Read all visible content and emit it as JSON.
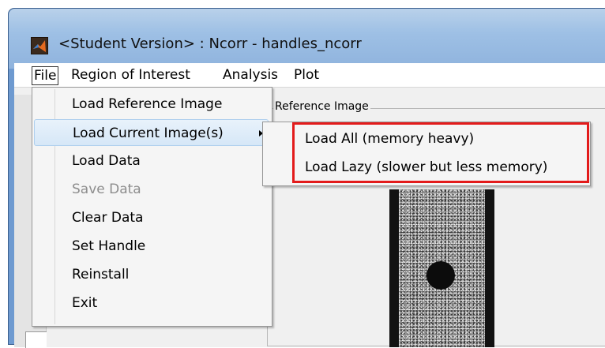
{
  "window": {
    "title": "<Student Version> : Ncorr - handles_ncorr",
    "icon": "matlab-icon"
  },
  "menubar": {
    "items": [
      "File",
      "Region of Interest",
      "Analysis",
      "Plot"
    ]
  },
  "file_menu": {
    "items": [
      {
        "label": "Load Reference Image",
        "enabled": true
      },
      {
        "label": "Load Current Image(s)",
        "enabled": true,
        "has_submenu": true,
        "highlighted": true
      },
      {
        "label": "Load Data",
        "enabled": true
      },
      {
        "label": "Save Data",
        "enabled": false
      },
      {
        "label": "Clear Data",
        "enabled": true
      },
      {
        "label": "Set Handle",
        "enabled": true
      },
      {
        "label": "Reinstall",
        "enabled": true
      },
      {
        "label": "Exit",
        "enabled": true
      }
    ]
  },
  "submenu": {
    "items": [
      {
        "label": "Load All (memory heavy)"
      },
      {
        "label": "Load Lazy (slower but less memory)"
      }
    ],
    "highlight_color": "#e31b1b"
  },
  "panel": {
    "reference_title": "Reference Image"
  }
}
